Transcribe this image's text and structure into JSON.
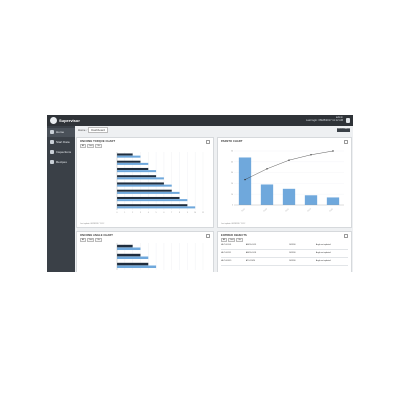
{
  "app": {
    "title": "Supervisor",
    "user_line1": "admin",
    "user_line2": "Last login: 08/28/2017 11:12 AM"
  },
  "nav": [
    {
      "label": "Home",
      "icon": "home-icon",
      "active": true
    },
    {
      "label": "Start Data",
      "icon": "data-icon"
    },
    {
      "label": "Inspections",
      "icon": "inspection-icon"
    },
    {
      "label": "Recipes",
      "icon": "recipe-icon"
    }
  ],
  "breadcrumb": [
    "Home",
    "Dashboard"
  ],
  "header_button": "CUSTOMIZE",
  "colors": {
    "bar_dark": "#1f2d3d",
    "bar_light": "#6fa8dc",
    "pareto_bar": "#6fa8dc",
    "pareto_line": "#333333"
  },
  "panels": {
    "torque_title": "ONCOME TORQUE CHART",
    "pareto_title": "PARETO CHART",
    "angle_title": "ONCOME ANGLE CHART",
    "expired_title": "EXPIRED OBJECTS",
    "torque_footer": "Last update: 08/28/2017 11:12",
    "pareto_footer": "Last update: 08/28/2017 11:12",
    "filter_chips": [
      "All",
      "Last",
      "Go"
    ]
  },
  "chart_data": [
    {
      "type": "bar",
      "title": "ONCOME TORQUE CHART",
      "categories": [
        "Product 1",
        "Product 2",
        "Product 3",
        "Product 4",
        "Product 5",
        "Product 6",
        "Product 7",
        "Product 8"
      ],
      "series": [
        {
          "values": [
            2,
            3,
            4,
            5,
            6,
            7,
            8,
            9
          ]
        },
        {
          "values": [
            3,
            4,
            5,
            6,
            7,
            8,
            9,
            10
          ]
        }
      ],
      "xlim": [
        0,
        11
      ]
    },
    {
      "type": "bar",
      "title": "PARETO CHART",
      "categories": [
        "Cat A",
        "Cat B",
        "Cat C",
        "Cat D",
        "Cat E"
      ],
      "values": [
        44,
        19,
        15,
        9,
        7
      ],
      "cumulative": [
        47,
        67,
        83,
        93,
        100
      ],
      "ylim": [
        0,
        50
      ]
    },
    {
      "type": "bar",
      "title": "ONCOME ANGLE CHART",
      "categories": [
        "Product 1",
        "Product 2",
        "Product 3"
      ],
      "series": [
        {
          "values": [
            2,
            3,
            4
          ]
        },
        {
          "values": [
            3,
            4,
            5
          ]
        }
      ],
      "xlim": [
        0,
        11
      ]
    }
  ],
  "expired": [
    {
      "name": "HE-T-001-01",
      "detail": "ABCD-01-19",
      "date": "10/2016",
      "status": "Angle not updated"
    },
    {
      "name": "HE-T-002-11",
      "detail": "ABCD-01-24",
      "date": "10/2016",
      "status": "Angle not updated"
    },
    {
      "name": "HE-T-003-19",
      "detail": "ATO-11024",
      "date": "10/2016",
      "status": "Angle not updated"
    }
  ]
}
